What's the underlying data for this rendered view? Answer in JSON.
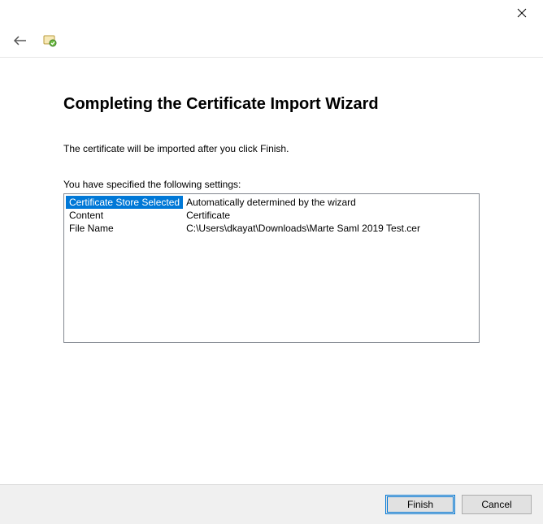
{
  "header": {
    "title": "Completing the Certificate Import Wizard",
    "intro": "The certificate will be imported after you click Finish.",
    "settings_label": "You have specified the following settings:"
  },
  "settings": {
    "rows": [
      {
        "key": "Certificate Store Selected",
        "value": "Automatically determined by the wizard",
        "selected": true
      },
      {
        "key": "Content",
        "value": "Certificate",
        "selected": false
      },
      {
        "key": "File Name",
        "value": "C:\\Users\\dkayat\\Downloads\\Marte Saml 2019 Test.cer",
        "selected": false
      }
    ]
  },
  "buttons": {
    "finish": "Finish",
    "cancel": "Cancel"
  }
}
